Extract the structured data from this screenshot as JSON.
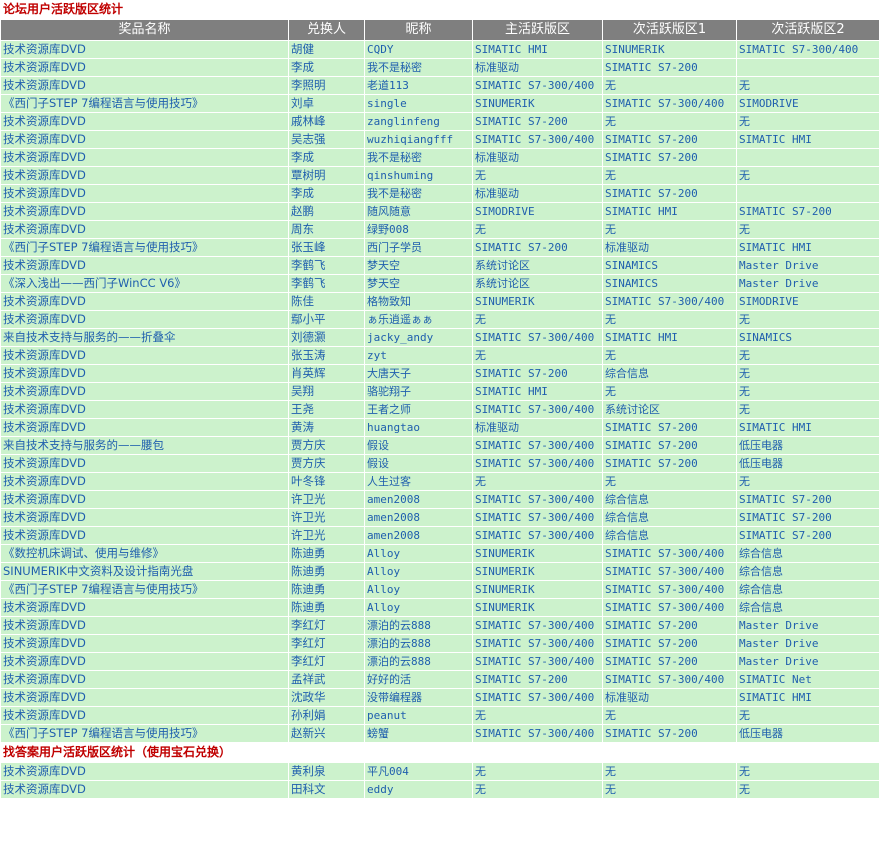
{
  "section1_title": "论坛用户活跃版区统计",
  "columns": [
    "奖品名称",
    "兑换人",
    "昵称",
    "主活跃版区",
    "次活跃版区1",
    "次活跃版区2"
  ],
  "rows": [
    [
      "技术资源库DVD",
      "胡健",
      "CQDY",
      "SIMATIC HMI",
      "SINUMERIK",
      "SIMATIC S7-300/400"
    ],
    [
      "技术资源库DVD",
      "李成",
      "我不是秘密",
      "标准驱动",
      "SIMATIC S7-200",
      ""
    ],
    [
      "技术资源库DVD",
      "李照明",
      "老道113",
      "SIMATIC S7-300/400",
      "无",
      "无"
    ],
    [
      "《西门子STEP 7编程语言与使用技巧》",
      "刘卓",
      "single",
      "SINUMERIK",
      "SIMATIC S7-300/400",
      "SIMODRIVE"
    ],
    [
      "技术资源库DVD",
      "戚林峰",
      "zanglinfeng",
      "SIMATIC S7-200",
      "无",
      "无"
    ],
    [
      "技术资源库DVD",
      "吴志强",
      "wuzhiqiangfff",
      "SIMATIC S7-300/400",
      "SIMATIC S7-200",
      "SIMATIC HMI"
    ],
    [
      "技术资源库DVD",
      "李成",
      "我不是秘密",
      "标准驱动",
      "SIMATIC S7-200",
      ""
    ],
    [
      "技术资源库DVD",
      "覃树明",
      "qinshuming",
      "无",
      "无",
      "无"
    ],
    [
      "技术资源库DVD",
      "李成",
      "我不是秘密",
      "标准驱动",
      "SIMATIC S7-200",
      ""
    ],
    [
      "技术资源库DVD",
      "赵鹏",
      "随风随意",
      "SIMODRIVE",
      "SIMATIC HMI",
      "SIMATIC S7-200"
    ],
    [
      "技术资源库DVD",
      "周东",
      "绿野008",
      "无",
      "无",
      "无"
    ],
    [
      "《西门子STEP 7编程语言与使用技巧》",
      "张玉峰",
      "西门子学员",
      "SIMATIC S7-200",
      "标准驱动",
      "SIMATIC HMI"
    ],
    [
      "技术资源库DVD",
      "李鹤飞",
      "梦天空",
      "系统讨论区",
      "SINAMICS",
      "Master Drive"
    ],
    [
      "《深入浅出——西门子WinCC V6》",
      "李鹤飞",
      "梦天空",
      "系统讨论区",
      "SINAMICS",
      "Master Drive"
    ],
    [
      "技术资源库DVD",
      "陈佳",
      "格物致知",
      "SINUMERIK",
      "SIMATIC S7-300/400",
      "SIMODRIVE"
    ],
    [
      "技术资源库DVD",
      "鄢小平",
      "ぁ乐逍遥ぁぁ",
      "无",
      "无",
      "无"
    ],
    [
      "来自技术支持与服务的——折叠伞",
      "刘德灏",
      "jacky_andy",
      "SIMATIC S7-300/400",
      "SIMATIC HMI",
      "SINAMICS"
    ],
    [
      "技术资源库DVD",
      "张玉涛",
      "zyt",
      "无",
      "无",
      "无"
    ],
    [
      "技术资源库DVD",
      "肖英辉",
      "大唐天子",
      "SIMATIC S7-200",
      "综合信息",
      "无"
    ],
    [
      "技术资源库DVD",
      "吴翔",
      "骆驼翔子",
      "SIMATIC HMI",
      "无",
      "无"
    ],
    [
      "技术资源库DVD",
      "王尧",
      "王者之师",
      "SIMATIC S7-300/400",
      "系统讨论区",
      "无"
    ],
    [
      "技术资源库DVD",
      "黄涛",
      "huangtao",
      "标准驱动",
      "SIMATIC S7-200",
      "SIMATIC HMI"
    ],
    [
      "来自技术支持与服务的——腰包",
      "贾方庆",
      "假设",
      "SIMATIC S7-300/400",
      "SIMATIC S7-200",
      "低压电器"
    ],
    [
      "技术资源库DVD",
      "贾方庆",
      "假设",
      "SIMATIC S7-300/400",
      "SIMATIC S7-200",
      "低压电器"
    ],
    [
      "技术资源库DVD",
      "叶冬锋",
      "人生过客",
      "无",
      "无",
      "无"
    ],
    [
      "技术资源库DVD",
      "许卫光",
      "amen2008",
      "SIMATIC S7-300/400",
      "综合信息",
      "SIMATIC S7-200"
    ],
    [
      "技术资源库DVD",
      "许卫光",
      "amen2008",
      "SIMATIC S7-300/400",
      "综合信息",
      "SIMATIC S7-200"
    ],
    [
      "技术资源库DVD",
      "许卫光",
      "amen2008",
      "SIMATIC S7-300/400",
      "综合信息",
      "SIMATIC S7-200"
    ],
    [
      "《数控机床调试、使用与维修》",
      "陈迪勇",
      "Alloy",
      "SINUMERIK",
      "SIMATIC S7-300/400",
      "综合信息"
    ],
    [
      "SINUMERIK中文资料及设计指南光盘",
      "陈迪勇",
      "Alloy",
      "SINUMERIK",
      "SIMATIC S7-300/400",
      "综合信息"
    ],
    [
      "《西门子STEP 7编程语言与使用技巧》",
      "陈迪勇",
      "Alloy",
      "SINUMERIK",
      "SIMATIC S7-300/400",
      "综合信息"
    ],
    [
      "技术资源库DVD",
      "陈迪勇",
      "Alloy",
      "SINUMERIK",
      "SIMATIC S7-300/400",
      "综合信息"
    ],
    [
      "技术资源库DVD",
      "李红灯",
      "漂泊的云888",
      "SIMATIC S7-300/400",
      "SIMATIC S7-200",
      "Master Drive"
    ],
    [
      "技术资源库DVD",
      "李红灯",
      "漂泊的云888",
      "SIMATIC S7-300/400",
      "SIMATIC S7-200",
      "Master Drive"
    ],
    [
      "技术资源库DVD",
      "李红灯",
      "漂泊的云888",
      "SIMATIC S7-300/400",
      "SIMATIC S7-200",
      "Master Drive"
    ],
    [
      "技术资源库DVD",
      "孟祥武",
      "好好的活",
      "SIMATIC S7-200",
      "SIMATIC S7-300/400",
      "SIMATIC Net"
    ],
    [
      "技术资源库DVD",
      "沈政华",
      "没带编程器",
      "SIMATIC S7-300/400",
      "标准驱动",
      "SIMATIC HMI"
    ],
    [
      "技术资源库DVD",
      "孙利娟",
      "peanut",
      "无",
      "无",
      "无"
    ],
    [
      "《西门子STEP 7编程语言与使用技巧》",
      "赵新兴",
      "螃蟹",
      "SIMATIC S7-300/400",
      "SIMATIC S7-200",
      "低压电器"
    ]
  ],
  "section2_title": "找答案用户活跃版区统计（使用宝石兑换）",
  "rows2": [
    [
      "技术资源库DVD",
      "黄利泉",
      "平凡004",
      "无",
      "无",
      "无"
    ],
    [
      "技术资源库DVD",
      "田科文",
      "eddy",
      "无",
      "无",
      "无"
    ]
  ]
}
